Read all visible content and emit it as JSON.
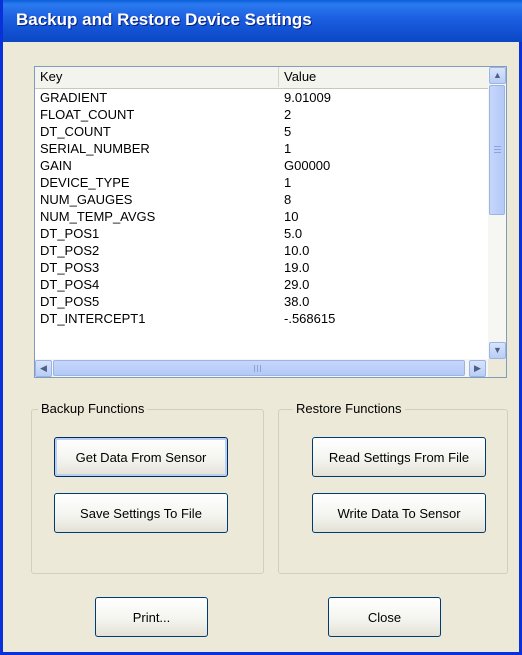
{
  "window": {
    "title": "Backup and Restore Device Settings"
  },
  "listview": {
    "columns": {
      "key": "Key",
      "value": "Value"
    },
    "rows": [
      {
        "key": "GRADIENT",
        "value": "9.01009"
      },
      {
        "key": "FLOAT_COUNT",
        "value": "2"
      },
      {
        "key": "DT_COUNT",
        "value": "5"
      },
      {
        "key": "SERIAL_NUMBER",
        "value": "1"
      },
      {
        "key": "GAIN",
        "value": "G00000"
      },
      {
        "key": "DEVICE_TYPE",
        "value": "1"
      },
      {
        "key": "NUM_GAUGES",
        "value": "8"
      },
      {
        "key": "NUM_TEMP_AVGS",
        "value": "10"
      },
      {
        "key": "DT_POS1",
        "value": "5.0"
      },
      {
        "key": "DT_POS2",
        "value": "10.0"
      },
      {
        "key": "DT_POS3",
        "value": "19.0"
      },
      {
        "key": "DT_POS4",
        "value": "29.0"
      },
      {
        "key": "DT_POS5",
        "value": "38.0"
      },
      {
        "key": "DT_INTERCEPT1",
        "value": "-.568615"
      }
    ]
  },
  "backup": {
    "label": "Backup Functions",
    "get_data": "Get Data From Sensor",
    "save_settings": "Save Settings To File"
  },
  "restore": {
    "label": "Restore Functions",
    "read_settings": "Read Settings From File",
    "write_data": "Write Data To Sensor"
  },
  "footer": {
    "print": "Print...",
    "close": "Close"
  },
  "icons": {
    "scroll_up": "arrow-up-icon",
    "scroll_down": "arrow-down-icon",
    "scroll_left": "arrow-left-icon",
    "scroll_right": "arrow-right-icon"
  },
  "colors": {
    "titlebar": "#1c5ee0",
    "dialog_bg": "#ece9d8",
    "button_border": "#003c74"
  }
}
